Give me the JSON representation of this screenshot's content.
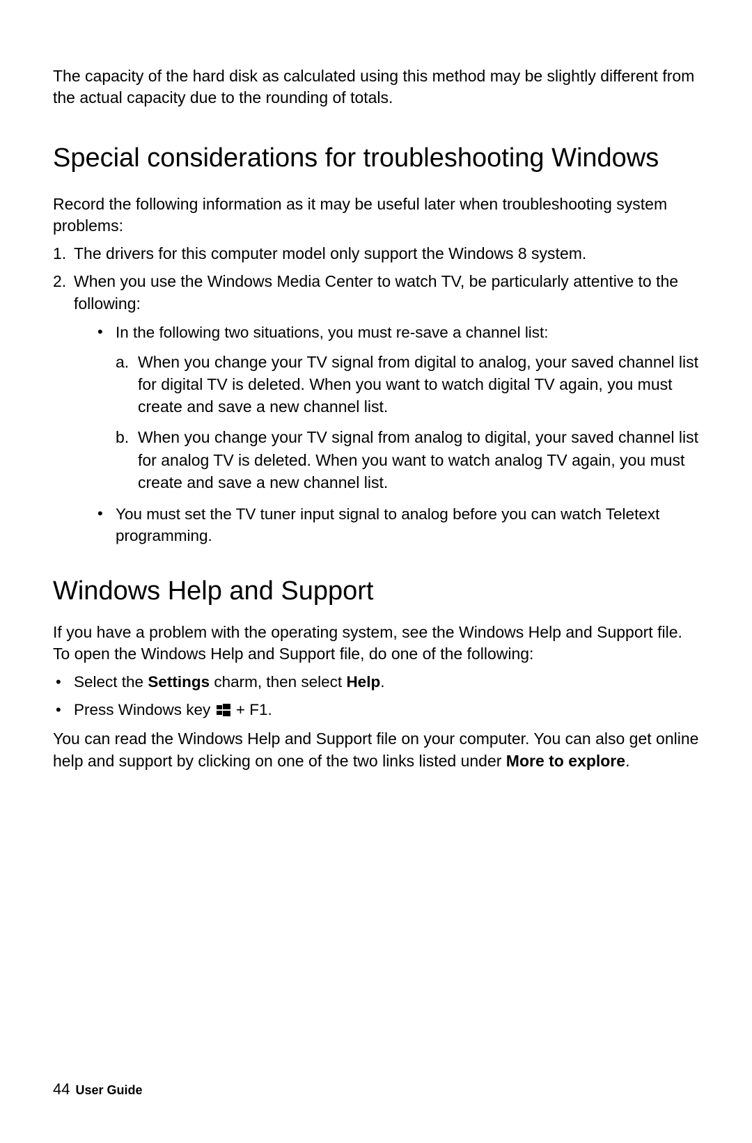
{
  "intro": "The capacity of the hard disk as calculated using this method may be slightly different from the actual capacity due to the rounding of totals.",
  "section1": {
    "heading": "Special considerations for troubleshooting Windows",
    "para": "Record the following information as it may be useful later when troubleshooting system problems:",
    "item1": "The drivers for this computer model only support the Windows 8 system.",
    "item2": "When you use the Windows Media Center to watch TV, be particularly attentive to the following:",
    "sub_bullet1": "In the following two situations, you must re-save a channel list:",
    "sub_a": "When you change your TV signal from digital to analog, your saved channel list for digital TV is deleted. When you want to watch digital TV again, you must create and save a new channel list.",
    "sub_b": "When you change your TV signal from analog to digital, your saved channel list for analog TV is deleted. When you want to watch analog TV again, you must create and save a new channel list.",
    "sub_bullet2": "You must set the TV tuner input signal to analog before you can watch Teletext programming."
  },
  "section2": {
    "heading": "Windows Help and Support",
    "para": "If you have a problem with the operating system, see the Windows Help and Support ﬁle. To open the Windows Help and Support ﬁle, do one of the following:",
    "bullet1_pre": "Select the ",
    "bullet1_b1": "Settings",
    "bullet1_mid": " charm, then select ",
    "bullet1_b2": "Help",
    "bullet1_post": ".",
    "bullet2_pre": "Press Windows key ",
    "bullet2_post": " + F1.",
    "closing_pre": "You can read the Windows Help and Support ﬁle on your computer. You can also get online help and support by clicking on one of the two links listed under ",
    "closing_bold": "More to explore",
    "closing_post": "."
  },
  "footer": {
    "page": "44",
    "title": "User Guide"
  }
}
